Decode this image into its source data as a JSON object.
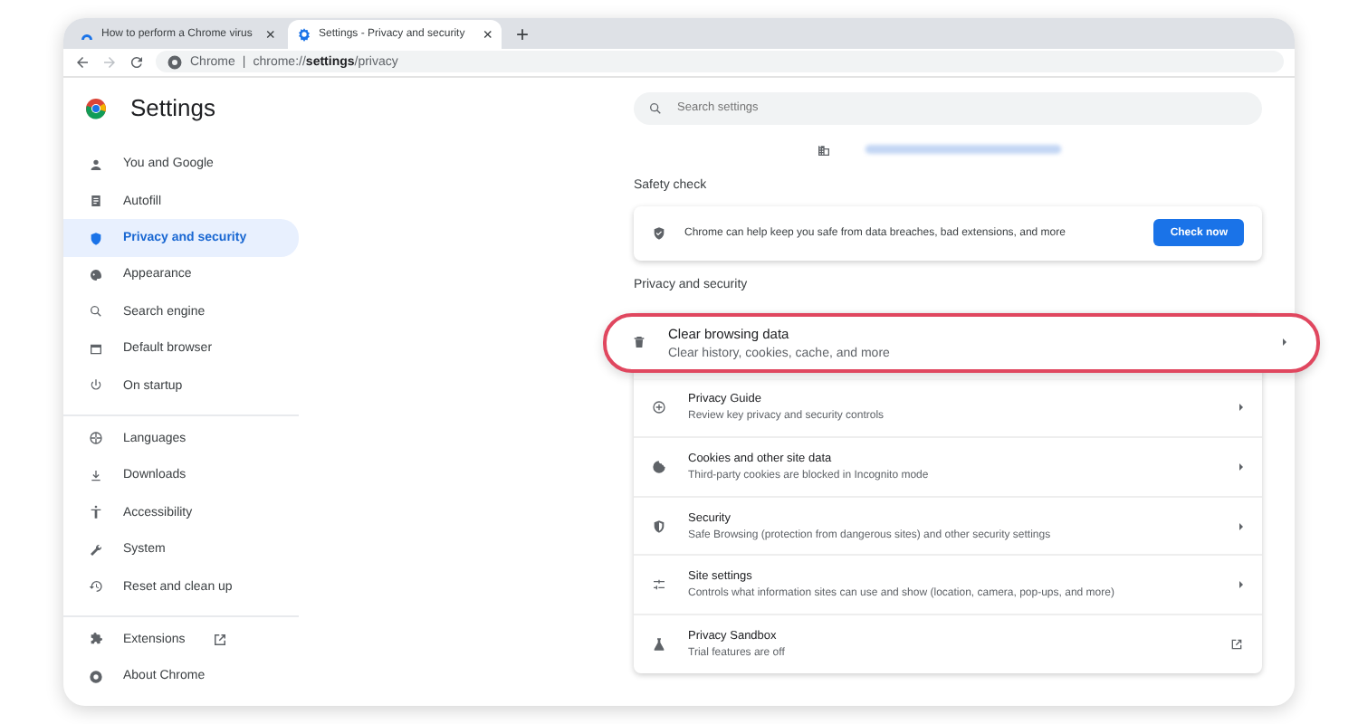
{
  "tabs": [
    {
      "title": "How to perform a Chrome virus",
      "close": "×",
      "selected": false
    },
    {
      "title": "Settings - Privacy and security",
      "close": "×",
      "selected": true
    }
  ],
  "new_tab": "+",
  "address_bar": {
    "chip": "Chrome",
    "separator": "|",
    "url": "chrome://**settings**/privacy"
  },
  "sidebar": {
    "title": "Settings",
    "sections": [
      {
        "items": [
          {
            "label": "You and Google",
            "selected": false,
            "kind": "page"
          },
          {
            "label": "Autofill",
            "selected": false,
            "kind": "page"
          },
          {
            "label": "Privacy and security",
            "selected": true,
            "kind": "page"
          },
          {
            "label": "Appearance",
            "selected": false,
            "kind": "page"
          },
          {
            "label": "Search engine",
            "selected": false,
            "kind": "page"
          },
          {
            "label": "Default browser",
            "selected": false,
            "kind": "page"
          },
          {
            "label": "On startup",
            "selected": false,
            "kind": "page"
          }
        ]
      },
      {
        "items": [
          {
            "label": "Languages",
            "selected": false,
            "kind": "page"
          },
          {
            "label": "Downloads",
            "selected": false,
            "kind": "page"
          },
          {
            "label": "Accessibility",
            "selected": false,
            "kind": "page"
          },
          {
            "label": "System",
            "selected": false,
            "kind": "page"
          },
          {
            "label": "Reset and clean up",
            "selected": false,
            "kind": "page"
          }
        ]
      },
      {
        "items": [
          {
            "label": "Extensions",
            "selected": false,
            "kind": "external"
          },
          {
            "label": "About Chrome",
            "selected": false,
            "kind": "page"
          }
        ]
      }
    ]
  },
  "search": {
    "placeholder": "Search settings"
  },
  "safety_check": {
    "heading": "Safety check",
    "text": "Chrome can help keep you safe from data breaches, bad extensions, and more",
    "button": "Check now"
  },
  "privacy": {
    "heading": "Privacy and security",
    "rows": [
      {
        "title": "Clear browsing data",
        "subtitle": "Clear history, cookies, cache, and more",
        "kind": "subpage",
        "highlighted": true
      },
      {
        "title": "Privacy Guide",
        "subtitle": "Review key privacy and security controls",
        "kind": "subpage",
        "highlighted": false
      },
      {
        "title": "Cookies and other site data",
        "subtitle": "Third-party cookies are blocked in Incognito mode",
        "kind": "subpage",
        "highlighted": false
      },
      {
        "title": "Security",
        "subtitle": "Safe Browsing (protection from dangerous sites) and other security settings",
        "kind": "subpage",
        "highlighted": false
      },
      {
        "title": "Site settings",
        "subtitle": "Controls what information sites can use and show (location, camera, pop-ups, and more)",
        "kind": "subpage",
        "highlighted": false
      },
      {
        "title": "Privacy Sandbox",
        "subtitle": "Trial features are off",
        "kind": "external",
        "highlighted": false
      }
    ]
  }
}
